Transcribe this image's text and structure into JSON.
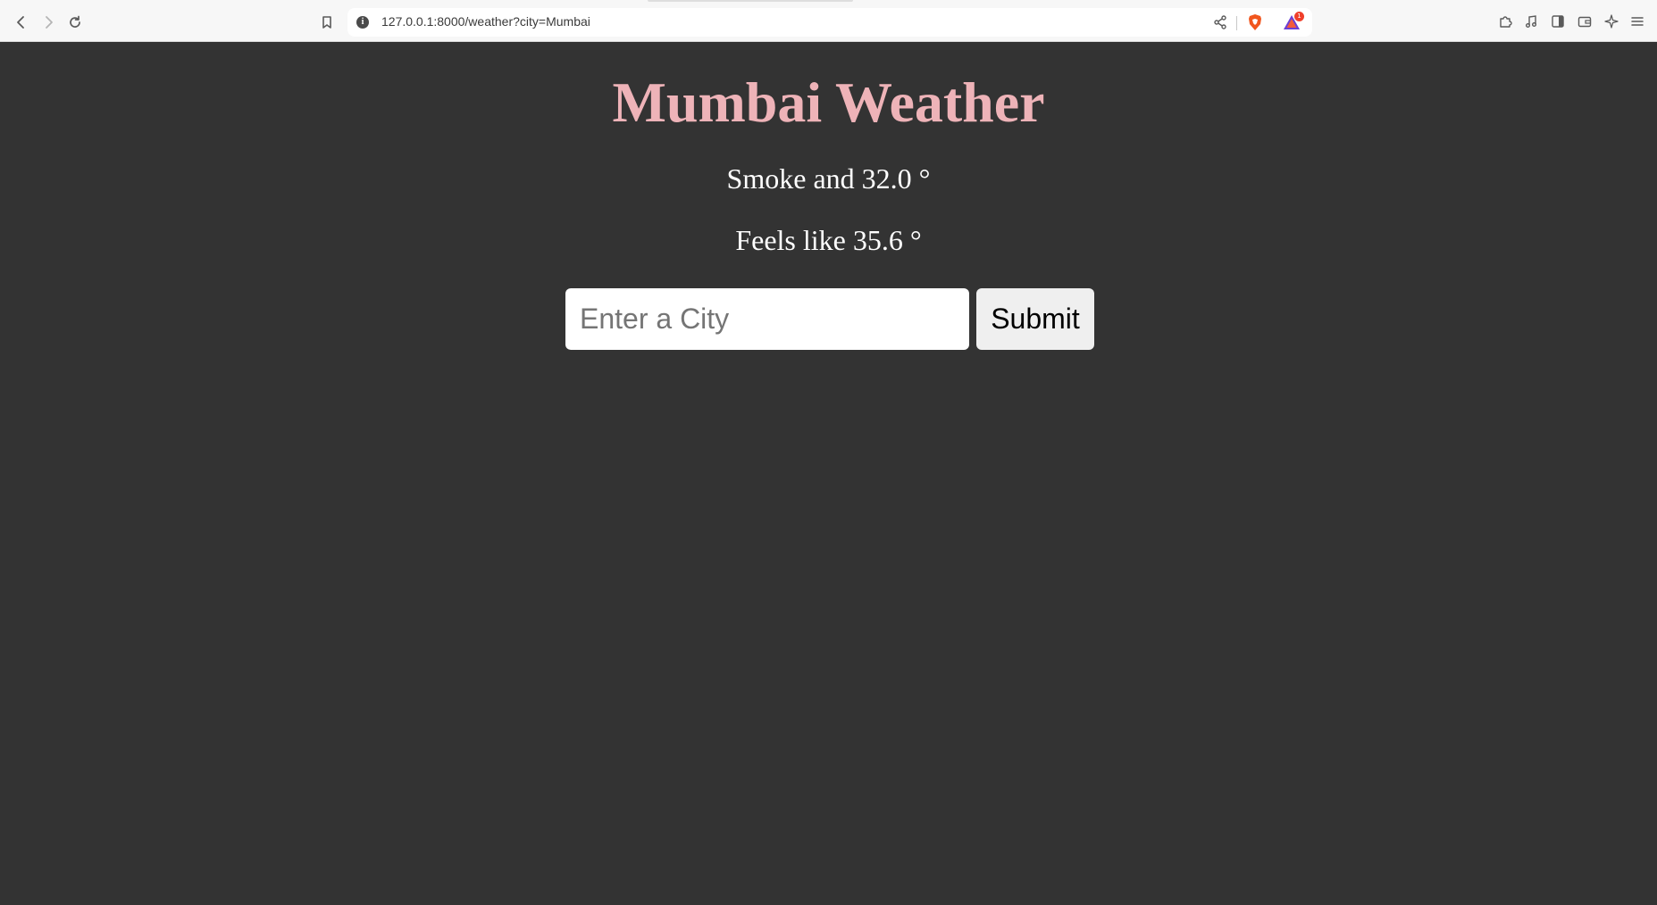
{
  "browser": {
    "url": "127.0.0.1:8000/weather?city=Mumbai",
    "rewards_badge": "1",
    "icons": {
      "back": "back-arrow-icon",
      "forward": "forward-arrow-icon",
      "reload": "reload-icon",
      "bookmark": "bookmark-icon",
      "info": "info-icon",
      "share": "share-icon",
      "brave": "brave-shields-icon",
      "rewards": "brave-rewards-icon",
      "extensions": "extensions-icon",
      "media": "music-note-icon",
      "sidebar": "sidebar-icon",
      "wallet": "wallet-icon",
      "leo": "leo-ai-icon",
      "menu": "hamburger-menu-icon"
    }
  },
  "page": {
    "title": "Mumbai Weather",
    "condition_line": "Smoke and 32.0 °",
    "feels_like_line": "Feels like 35.6 °",
    "search": {
      "placeholder": "Enter a City",
      "value": "",
      "submit_label": "Submit"
    }
  },
  "colors": {
    "background": "#333333",
    "title": "#eeb3b8",
    "text": "#ffffff",
    "input_bg": "#ffffff",
    "button_bg": "#efefef"
  }
}
